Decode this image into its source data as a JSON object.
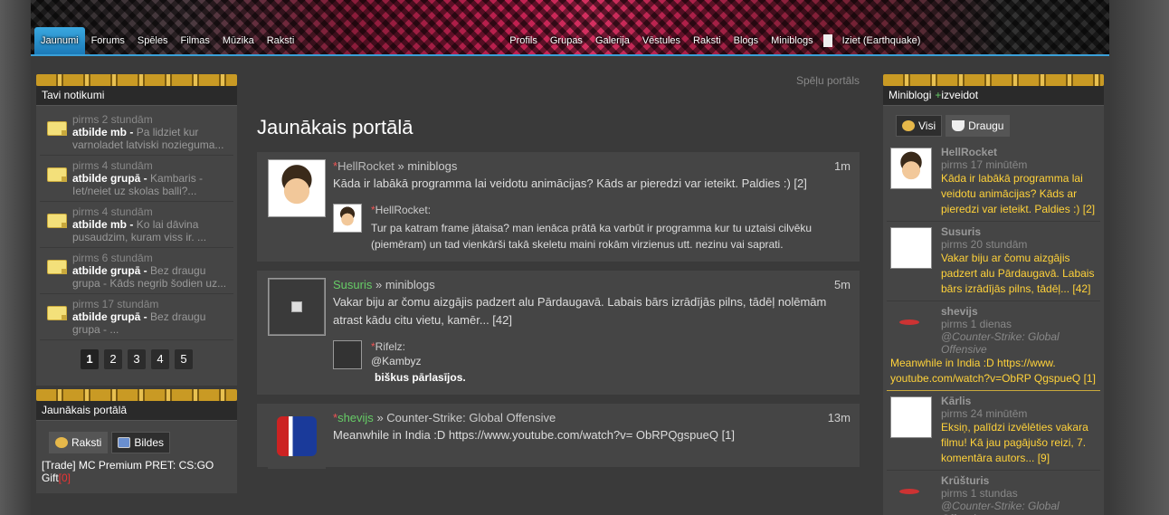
{
  "nav": {
    "items": [
      "Jaunumi",
      "Forums",
      "Spēles",
      "Filmas",
      "Mūzika",
      "Raksti",
      "Profils",
      "Grupas",
      "Galerija",
      "Vēstules",
      "Raksti",
      "Blogs",
      "Miniblogs",
      "Iziet (Earthquake)"
    ]
  },
  "left": {
    "notifications_title": "Tavi notikumi",
    "notifications": [
      {
        "time": "pirms 2 stundām",
        "bold": "atbilde mb -",
        "rest": "Pa lidziet kur varnoladet latviski nozieguma..."
      },
      {
        "time": "pirms 4 stundām",
        "bold": "atbilde grupā -",
        "rest": "Kambaris - Iet/neiet uz skolas balli?..."
      },
      {
        "time": "pirms 4 stundām",
        "bold": "atbilde mb -",
        "rest": "Ko lai dāvina pusaudzim, kuram viss ir. ..."
      },
      {
        "time": "pirms 6 stundām",
        "bold": "atbilde grupā -",
        "rest": "Bez draugu grupa - Kāds negrib šodien uz..."
      },
      {
        "time": "pirms 17 stundām",
        "bold": "atbilde grupā -",
        "rest": "Bez draugu grupa - ..."
      }
    ],
    "pages": [
      "1",
      "2",
      "3",
      "4",
      "5"
    ],
    "portal_title": "Jaunākais portālā",
    "portal_tabs": [
      "Raksti",
      "Bildes"
    ],
    "portal_link": {
      "text": "[Trade] MC Premium PRET: CS:GO Gift",
      "count": "[0]"
    }
  },
  "main": {
    "crumb": "Spēļu portāls",
    "heading": "Jaunākais portālā",
    "posts": [
      {
        "author": "HellRocket",
        "sep": "»",
        "category": "miniblogs",
        "age": "1m",
        "text": "Kāda ir labākā programma lai veidotu animācijas? Kāds ar pieredzi var ieteikt. Paldies :) [2]",
        "reply_name": "HellRocket:",
        "reply_text": "Tur pa katram frame jātaisa? man ienāca prātā ka varbūt ir programma kur tu uztaisi cilvēku (piemēram) un tad vienkārši takā skeletu maini rokām virzienus utt. nezinu vai saprati."
      },
      {
        "author": "Susuris",
        "sep": "»",
        "category": "miniblogs",
        "age": "5m",
        "text": "Vakar biju ar čomu aizgājis padzert alu Pārdaugavā. Labais bārs izrādījās pilns, tādēļ nolēmām atrast kādu citu vietu, kamēr... [42]",
        "reply_name": "Rifelz:",
        "reply_text": "@Kambyz",
        "reply_text2": "biškus pārlasījos."
      },
      {
        "author": "shevijs",
        "sep": "»",
        "category": "Counter-Strike: Global Offensive",
        "age": "13m",
        "text": "Meanwhile in India :D https://www.youtube.com/watch?v= ObRPQgspueQ [1]"
      }
    ]
  },
  "right": {
    "title": "Miniblogi",
    "create": "izveidot",
    "tabs": [
      "Visi",
      "Draugu"
    ],
    "items": [
      {
        "name": "HellRocket",
        "time": "pirms 17 minūtēm",
        "game": "",
        "text": "Kāda ir labākā programma lai veidotu animācijas? Kāds ar pieredzi var ieteikt. Paldies :) [2]"
      },
      {
        "name": "Susuris",
        "time": "pirms 20 stundām",
        "game": "",
        "text": "Vakar biju ar čomu aizgājis padzert alu Pārdaugavā. Labais bārs izrādījās pilns, tādēļ... [42]"
      },
      {
        "name": "shevijs",
        "time": "pirms 1 dienas",
        "game": "@Counter-Strike: Global Offensive",
        "text": "Meanwhile in India :D https://www. youtube.com/watch?v=ObRP QgspueQ [1]"
      },
      {
        "name": "Kārlis",
        "time": "pirms 24 minūtēm",
        "game": "",
        "text": "Eksiņ, palīdzi izvēlēties vakara filmu! Kā jau pagājušo reizi, 7. komentāra autors... [9]"
      },
      {
        "name": "Krūšturis",
        "time": "pirms 1 stundas",
        "game": "@Counter-Strike: Global Offensive",
        "text": ""
      }
    ]
  },
  "colors": {
    "accent": "#3aa8e0",
    "gold": "#ffd23a",
    "green": "#66cc66",
    "star": "#ee5555"
  }
}
